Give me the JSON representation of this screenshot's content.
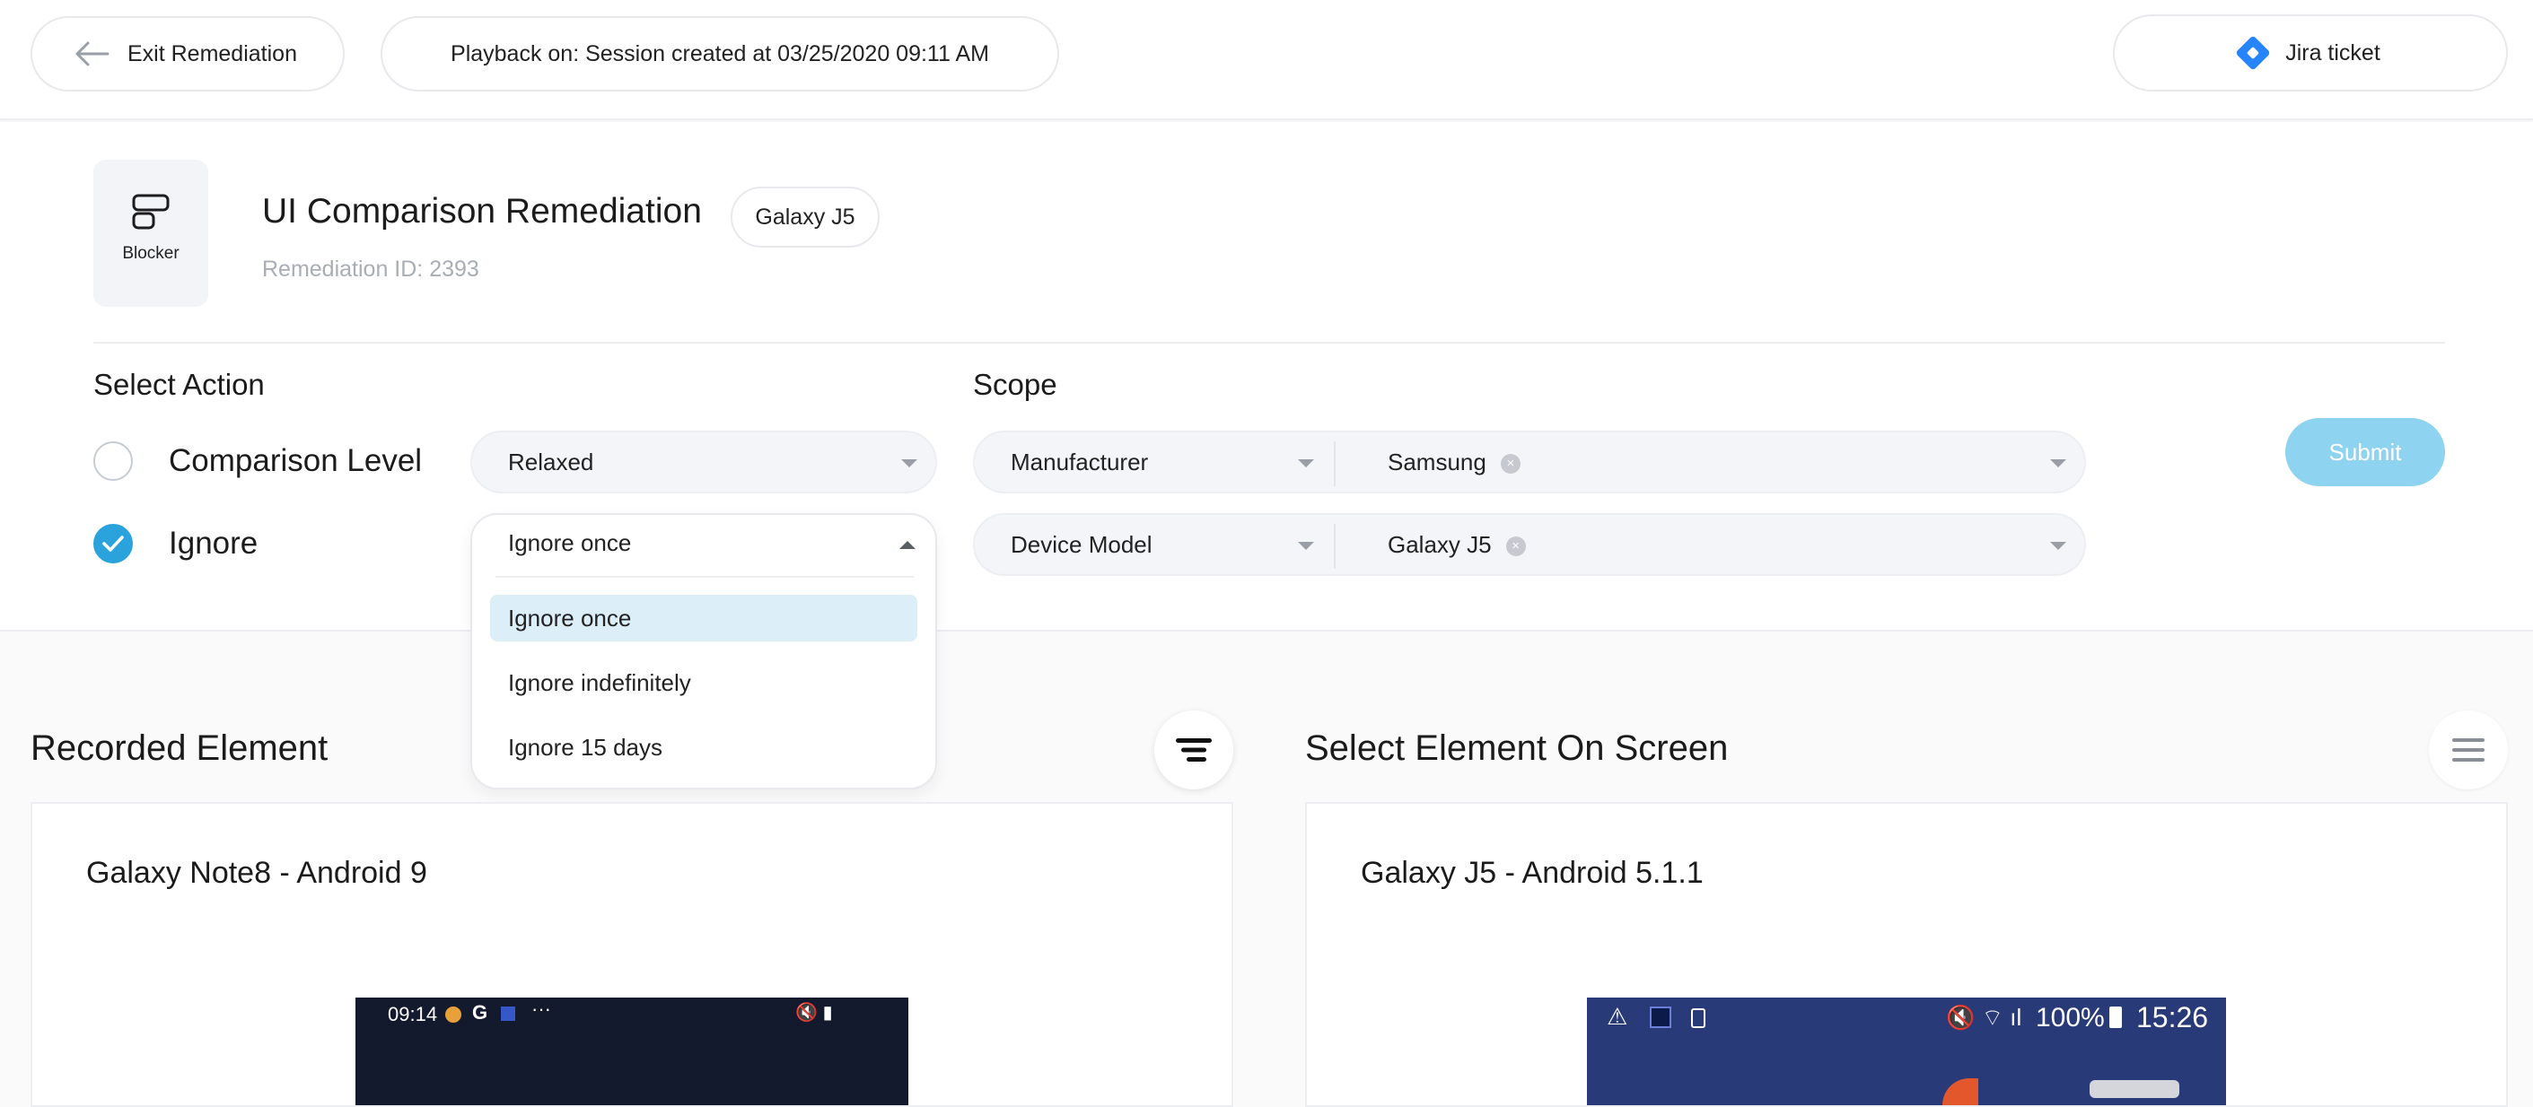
{
  "topbar": {
    "exit_label": "Exit Remediation",
    "playback_label": "Playback on: Session created at 03/25/2020 09:11 AM",
    "jira_label": "Jira ticket"
  },
  "header": {
    "severity_label": "Blocker",
    "title": "UI Comparison Remediation",
    "device_tag": "Galaxy J5",
    "remediation_id": "Remediation ID: 2393"
  },
  "action": {
    "section_title": "Select Action",
    "options": [
      {
        "label": "Comparison Level",
        "checked": false,
        "select_value": "Relaxed"
      },
      {
        "label": "Ignore",
        "checked": true,
        "select_value": "Ignore once"
      }
    ],
    "ignore_dropdown": {
      "open": true,
      "items": [
        "Ignore once",
        "Ignore indefinitely",
        "Ignore 15 days"
      ],
      "selected": "Ignore once"
    }
  },
  "scope": {
    "section_title": "Scope",
    "rows": [
      {
        "key": "Manufacturer",
        "value": "Samsung"
      },
      {
        "key": "Device Model",
        "value": "Galaxy J5"
      }
    ]
  },
  "submit_label": "Submit",
  "recorded": {
    "title": "Recorded Element",
    "device": "Galaxy Note8 - Android 9",
    "status_time": "09:14"
  },
  "select_on_screen": {
    "title": "Select Element On Screen",
    "device": "Galaxy J5 - Android 5.1.1",
    "status_battery": "100%",
    "status_time": "15:26"
  },
  "colors": {
    "accent": "#2aa3dd",
    "submit_disabled": "#8ed3ef",
    "jira": "#2684ff",
    "selected_option_bg": "#dceff9"
  }
}
